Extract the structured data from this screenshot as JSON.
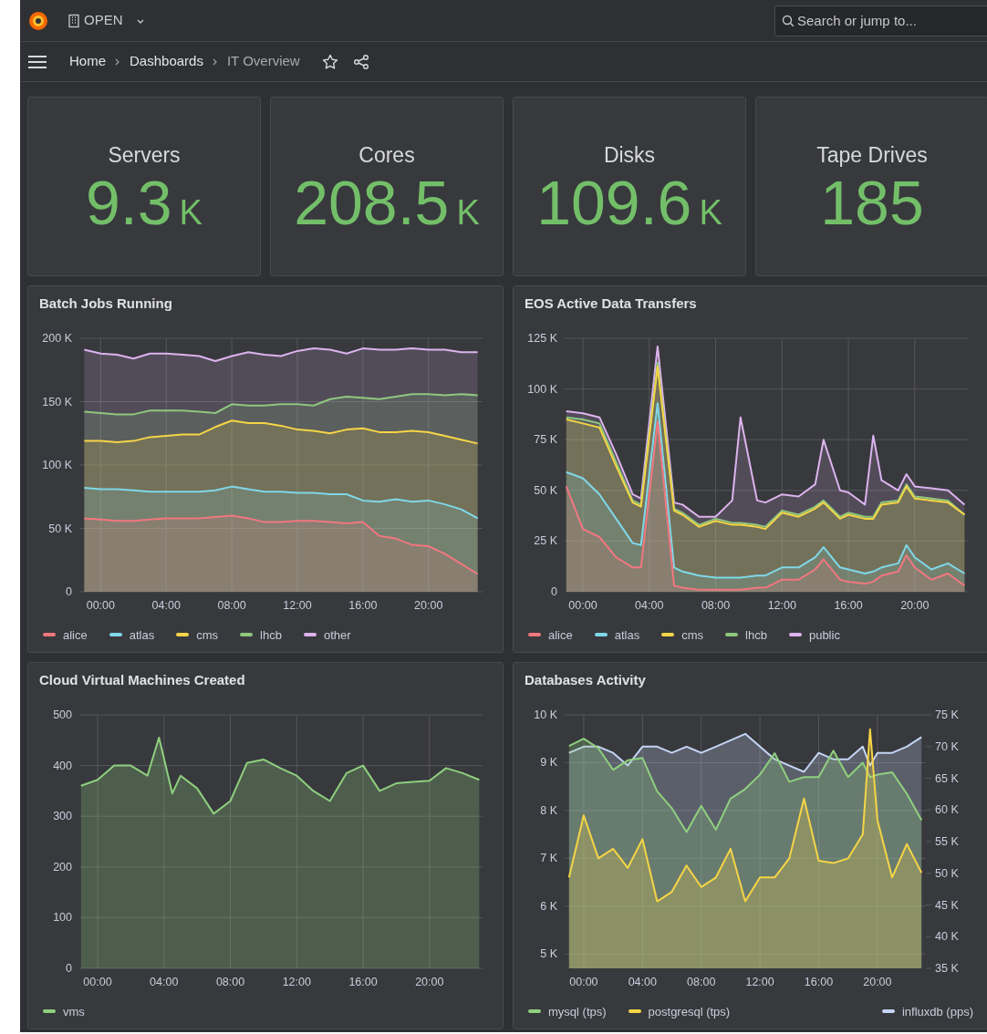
{
  "topbar": {
    "org": "OPEN",
    "search": {
      "placeholder": "Search or jump to..."
    }
  },
  "breadcrumbs": [
    {
      "label": "Home",
      "current": false
    },
    {
      "label": "Dashboards",
      "current": false
    },
    {
      "label": "IT Overview",
      "current": true
    }
  ],
  "stats": [
    {
      "title": "Servers",
      "value": "9.3",
      "unit": "K"
    },
    {
      "title": "Cores",
      "value": "208.5",
      "unit": "K"
    },
    {
      "title": "Disks",
      "value": "109.6",
      "unit": "K"
    },
    {
      "title": "Tape Drives",
      "value": "185"
    }
  ],
  "panels": [
    {
      "title": "Batch Jobs Running",
      "chart_data": {
        "type": "area",
        "stacked": false,
        "grid": true,
        "x": [
          -1,
          0,
          1,
          2,
          3,
          4,
          5,
          6,
          7,
          8,
          9,
          10,
          11,
          12,
          13,
          14,
          15,
          16,
          17,
          18,
          19,
          20,
          21,
          22,
          23
        ],
        "xlim": [
          -1.3,
          23.3
        ],
        "ylim": [
          0,
          200
        ],
        "xticks": [
          {
            "value": 0,
            "label": "00:00"
          },
          {
            "value": 4,
            "label": "04:00"
          },
          {
            "value": 8,
            "label": "08:00"
          },
          {
            "value": 12,
            "label": "12:00"
          },
          {
            "value": 16,
            "label": "16:00"
          },
          {
            "value": 20,
            "label": "20:00"
          }
        ],
        "yticks": [
          {
            "value": 0,
            "label": "0"
          },
          {
            "value": 50,
            "label": "50 K"
          },
          {
            "value": 100,
            "label": "100 K"
          },
          {
            "value": 150,
            "label": "150 K"
          },
          {
            "value": 200,
            "label": "200 K"
          }
        ],
        "series": [
          {
            "name": "alice",
            "color": "#f2777f",
            "values": [
              58,
              57,
              56,
              56,
              57,
              58,
              58,
              58,
              59,
              60,
              58,
              55,
              55,
              56,
              56,
              55,
              54,
              55,
              44,
              42,
              37,
              36,
              30,
              22,
              14
            ]
          },
          {
            "name": "atlas",
            "color": "#7fd8e8",
            "values": [
              82,
              81,
              81,
              80,
              79,
              79,
              79,
              79,
              80,
              83,
              81,
              79,
              79,
              78,
              78,
              77,
              77,
              72,
              71,
              73,
              71,
              72,
              69,
              65,
              58
            ]
          },
          {
            "name": "cms",
            "color": "#f5d547",
            "values": [
              119,
              119,
              118,
              119,
              122,
              123,
              124,
              124,
              130,
              135,
              133,
              133,
              131,
              128,
              127,
              125,
              128,
              129,
              126,
              126,
              127,
              126,
              123,
              120,
              117
            ]
          },
          {
            "name": "lhcb",
            "color": "#8fc77e",
            "values": [
              142,
              141,
              140,
              140,
              143,
              143,
              143,
              142,
              141,
              148,
              147,
              147,
              148,
              148,
              147,
              152,
              154,
              153,
              152,
              154,
              156,
              156,
              155,
              156,
              155
            ]
          },
          {
            "name": "other",
            "color": "#dcb3ee",
            "values": [
              191,
              188,
              187,
              184,
              188,
              188,
              187,
              186,
              182,
              186,
              189,
              187,
              186,
              190,
              192,
              191,
              188,
              192,
              191,
              191,
              192,
              191,
              191,
              189,
              189
            ]
          }
        ]
      }
    },
    {
      "title": "EOS Active Data Transfers",
      "chart_data": {
        "type": "area",
        "stacked": false,
        "grid": true,
        "x": [
          -1,
          0,
          1,
          2,
          3,
          3.5,
          4.5,
          5.5,
          6,
          7,
          8,
          9,
          9.5,
          10.5,
          11,
          12,
          13,
          14,
          14.5,
          15.5,
          16,
          17,
          17.5,
          18,
          19,
          19.5,
          20,
          21,
          22,
          23
        ],
        "xlim": [
          -1.1,
          23.2
        ],
        "ylim": [
          0,
          125
        ],
        "xticks": [
          {
            "value": 0,
            "label": "00:00"
          },
          {
            "value": 4,
            "label": "04:00"
          },
          {
            "value": 8,
            "label": "08:00"
          },
          {
            "value": 12,
            "label": "12:00"
          },
          {
            "value": 16,
            "label": "16:00"
          },
          {
            "value": 20,
            "label": "20:00"
          }
        ],
        "yticks": [
          {
            "value": 0,
            "label": "0"
          },
          {
            "value": 25,
            "label": "25 K"
          },
          {
            "value": 50,
            "label": "50 K"
          },
          {
            "value": 75,
            "label": "75 K"
          },
          {
            "value": 100,
            "label": "100 K"
          },
          {
            "value": 125,
            "label": "125 K"
          }
        ],
        "series": [
          {
            "name": "alice",
            "color": "#f2777f",
            "values": [
              52,
              31,
              27,
              17,
              12,
              12,
              84,
              3,
              2,
              1,
              1,
              1,
              1,
              2,
              2,
              6,
              6,
              11,
              16,
              6,
              5,
              4,
              5,
              8,
              10,
              18,
              12,
              6,
              9,
              3
            ]
          },
          {
            "name": "atlas",
            "color": "#7fd8e8",
            "values": [
              59,
              56,
              48,
              36,
              24,
              23,
              93,
              12,
              10,
              8,
              7,
              7,
              7,
              8,
              8,
              12,
              12,
              17,
              22,
              12,
              11,
              9,
              10,
              12,
              14,
              23,
              17,
              11,
              14,
              9
            ]
          },
          {
            "name": "cms",
            "color": "#f5d547",
            "values": [
              85,
              83,
              81,
              62,
              44,
              42,
              111,
              40,
              38,
              32,
              35,
              33,
              33,
              32,
              31,
              39,
              37,
              41,
              44,
              36,
              38,
              36,
              36,
              43,
              44,
              52,
              46,
              45,
              44,
              38
            ]
          },
          {
            "name": "lhcb",
            "color": "#8fc77e",
            "values": [
              86,
              85,
              83,
              64,
              45,
              43,
              113,
              41,
              39,
              33,
              36,
              34,
              34,
              33,
              32,
              40,
              38,
              42,
              45,
              37,
              39,
              37,
              37,
              44,
              45,
              53,
              47,
              46,
              45,
              38
            ]
          },
          {
            "name": "public",
            "color": "#dcb3ee",
            "values": [
              89,
              88,
              86,
              68,
              48,
              46,
              121,
              44,
              43,
              37,
              37,
              45,
              86,
              45,
              44,
              48,
              47,
              53,
              75,
              50,
              49,
              43,
              77,
              55,
              50,
              58,
              52,
              51,
              50,
              43
            ]
          }
        ]
      }
    },
    {
      "title": "Cloud Virtual Machines Created",
      "chart_data": {
        "type": "area",
        "grid": true,
        "x": [
          -1,
          0,
          1,
          2,
          3,
          3.7,
          4.5,
          5,
          6,
          7,
          8,
          9,
          10,
          11,
          12,
          13,
          14,
          15,
          16,
          17,
          18,
          19,
          20,
          21,
          22,
          23
        ],
        "xlim": [
          -1.1,
          23.2
        ],
        "ylim": [
          0,
          500
        ],
        "xticks": [
          {
            "value": 0,
            "label": "00:00"
          },
          {
            "value": 4,
            "label": "04:00"
          },
          {
            "value": 8,
            "label": "08:00"
          },
          {
            "value": 12,
            "label": "12:00"
          },
          {
            "value": 16,
            "label": "16:00"
          },
          {
            "value": 20,
            "label": "20:00"
          }
        ],
        "yticks": [
          0,
          100,
          200,
          300,
          400,
          500
        ],
        "series": [
          {
            "name": "vms",
            "color": "#8fd07f",
            "values": [
              360,
              372,
              400,
              400,
              380,
              455,
              345,
              380,
              355,
              305,
              330,
              405,
              412,
              395,
              380,
              350,
              330,
              385,
              400,
              350,
              365,
              368,
              370,
              395,
              385,
              372
            ]
          }
        ]
      }
    },
    {
      "title": "Databases Activity",
      "chart_data": {
        "type": "area",
        "grid": true,
        "x": [
          -1,
          0,
          1,
          2,
          3,
          4,
          5,
          6,
          7,
          8,
          9,
          10,
          11,
          12,
          13,
          14,
          15,
          16,
          17,
          18,
          19,
          19.5,
          20,
          21,
          22,
          23
        ],
        "xlim": [
          -1.3,
          23.3
        ],
        "ylim": [
          4.7,
          10
        ],
        "y2lim": [
          35,
          75
        ],
        "xticks": [
          {
            "value": 0,
            "label": "00:00"
          },
          {
            "value": 4,
            "label": "04:00"
          },
          {
            "value": 8,
            "label": "08:00"
          },
          {
            "value": 12,
            "label": "12:00"
          },
          {
            "value": 16,
            "label": "16:00"
          },
          {
            "value": 20,
            "label": "20:00"
          }
        ],
        "yticks": [
          {
            "value": 5,
            "label": "5 K"
          },
          {
            "value": 6,
            "label": "6 K"
          },
          {
            "value": 7,
            "label": "7 K"
          },
          {
            "value": 8,
            "label": "8 K"
          },
          {
            "value": 9,
            "label": "9 K"
          },
          {
            "value": 10,
            "label": "10 K"
          }
        ],
        "y2ticks": [
          {
            "value": 35,
            "label": "35 K"
          },
          {
            "value": 40,
            "label": "40 K"
          },
          {
            "value": 45,
            "label": "45 K"
          },
          {
            "value": 50,
            "label": "50 K"
          },
          {
            "value": 55,
            "label": "55 K"
          },
          {
            "value": 60,
            "label": "60 K"
          },
          {
            "value": 65,
            "label": "65 K"
          },
          {
            "value": 70,
            "label": "70 K"
          },
          {
            "value": 75,
            "label": "75 K"
          }
        ],
        "series": [
          {
            "name": "mysql (tps)",
            "color": "#8fd07f",
            "values": [
              9.35,
              9.5,
              9.3,
              8.85,
              9.05,
              9.1,
              8.4,
              8.05,
              7.55,
              8.1,
              7.6,
              8.25,
              8.45,
              8.75,
              9.2,
              8.6,
              8.7,
              8.7,
              9.25,
              8.7,
              9.0,
              8.7,
              8.75,
              8.8,
              8.35,
              7.8
            ]
          },
          {
            "name": "postgresql (tps)",
            "color": "#f5d547",
            "values": [
              6.6,
              7.9,
              7.0,
              7.2,
              6.8,
              7.4,
              6.1,
              6.3,
              6.85,
              6.4,
              6.6,
              7.2,
              6.1,
              6.6,
              6.6,
              7.0,
              8.25,
              6.95,
              6.9,
              7.0,
              7.5,
              9.7,
              7.8,
              6.6,
              7.3,
              6.7
            ]
          },
          {
            "name": "influxdb (pps)",
            "color": "#c5d5f5",
            "axis": "y2",
            "values": [
              69,
              70,
              70,
              69,
              67,
              70,
              70,
              69,
              70,
              69,
              70,
              71,
              72,
              70,
              68,
              67,
              66,
              69,
              68,
              68,
              70,
              67,
              69,
              69,
              70,
              71.5
            ]
          }
        ]
      }
    }
  ]
}
